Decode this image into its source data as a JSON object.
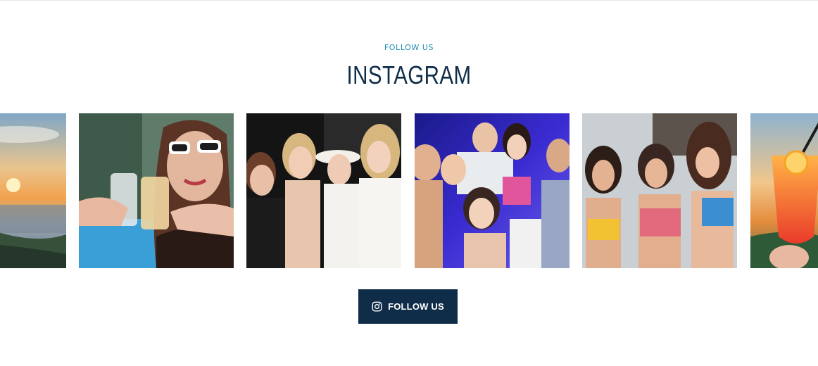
{
  "section": {
    "eyebrow": "FOLLOW US",
    "title": "INSTAGRAM"
  },
  "feed": {
    "photos": [
      {
        "subject": "sunset over the sea"
      },
      {
        "subject": "woman in white sunglasses toasting cocktails"
      },
      {
        "subject": "group of four women posing at night"
      },
      {
        "subject": "group of friends at a neon-lit party"
      },
      {
        "subject": "three women in bikinis on a rooftop"
      },
      {
        "subject": "orange cocktail against a sunset"
      }
    ]
  },
  "cta": {
    "label": "FOLLOW US",
    "icon": "instagram-icon"
  },
  "colors": {
    "accent": "#1e8eb4",
    "brand": "#0f2d49",
    "background": "#ffffff"
  }
}
